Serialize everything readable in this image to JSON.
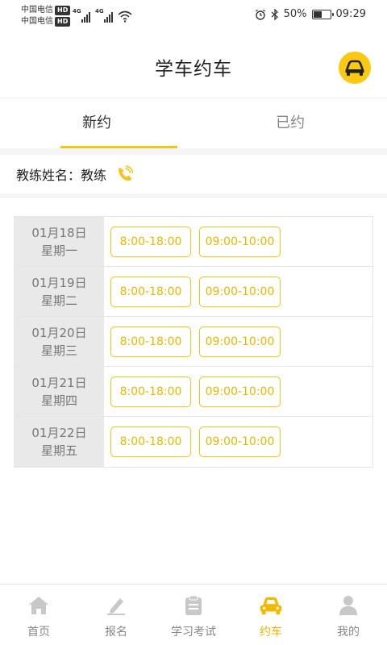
{
  "status_bar": {
    "carrier1": "中国电信",
    "carrier2": "中国电信",
    "hd": "HD",
    "network_tag": "4G",
    "battery_percent": "50%",
    "battery_level": 0.5,
    "time": "09:29"
  },
  "header": {
    "title": "学车约车"
  },
  "tabs": [
    {
      "label": "新约",
      "active": true
    },
    {
      "label": "已约",
      "active": false
    }
  ],
  "coach": {
    "label": "教练姓名：",
    "name": "教练"
  },
  "schedule": [
    {
      "date": "01月18日",
      "weekday": "星期一",
      "slots": [
        "8:00-18:00",
        "09:00-10:00"
      ]
    },
    {
      "date": "01月19日",
      "weekday": "星期二",
      "slots": [
        "8:00-18:00",
        "09:00-10:00"
      ]
    },
    {
      "date": "01月20日",
      "weekday": "星期三",
      "slots": [
        "8:00-18:00",
        "09:00-10:00"
      ]
    },
    {
      "date": "01月21日",
      "weekday": "星期四",
      "slots": [
        "8:00-18:00",
        "09:00-10:00"
      ]
    },
    {
      "date": "01月22日",
      "weekday": "星期五",
      "slots": [
        "8:00-18:00",
        "09:00-10:00"
      ]
    }
  ],
  "bottom_nav": [
    {
      "label": "首页",
      "icon": "home-icon",
      "active": false
    },
    {
      "label": "报名",
      "icon": "edit-icon",
      "active": false
    },
    {
      "label": "学习考试",
      "icon": "clipboard-icon",
      "active": false
    },
    {
      "label": "约车",
      "icon": "car-icon",
      "active": true
    },
    {
      "label": "我的",
      "icon": "user-icon",
      "active": false
    }
  ],
  "colors": {
    "accent": "#f5c518",
    "slot_text": "#e6b800",
    "nav_inactive": "#c8c8c8"
  }
}
